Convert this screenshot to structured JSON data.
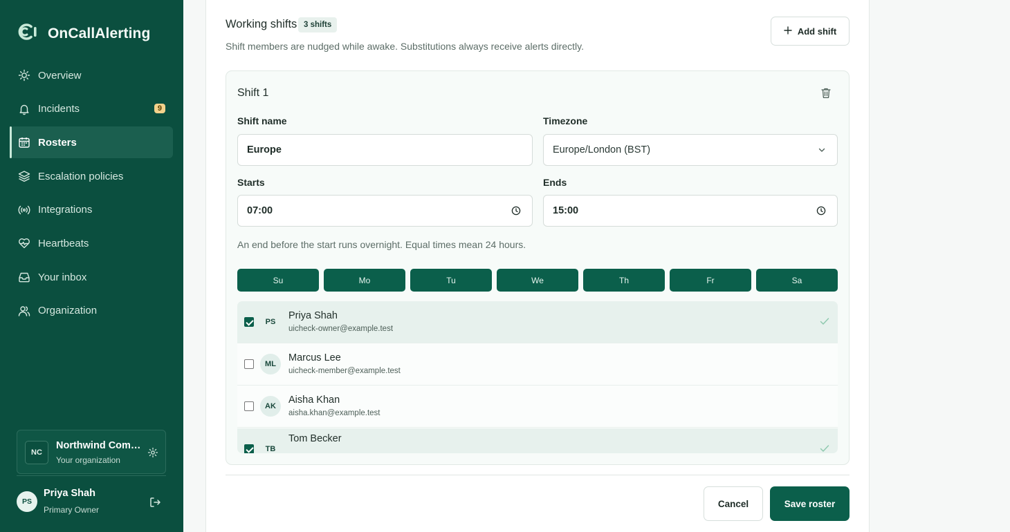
{
  "app": {
    "name": "OnCallAlerting"
  },
  "colors": {
    "sidebar": "#0b4f3f",
    "accent": "#0b5f4b",
    "badge": "#f3d28c"
  },
  "sidebar": {
    "items": [
      {
        "label": "Overview",
        "icon": "sun-icon"
      },
      {
        "label": "Incidents",
        "icon": "bell-icon",
        "badge": "9"
      },
      {
        "label": "Rosters",
        "icon": "calendar-icon",
        "active": true
      },
      {
        "label": "Escalation policies",
        "icon": "layers-icon"
      },
      {
        "label": "Integrations",
        "icon": "broadcast-icon"
      },
      {
        "label": "Heartbeats",
        "icon": "heart-pulse-icon"
      },
      {
        "label": "Your inbox",
        "icon": "inbox-icon"
      },
      {
        "label": "Organization",
        "icon": "users-icon"
      }
    ],
    "org": {
      "initials": "NC",
      "name": "Northwind Com…",
      "subtitle": "Your organization"
    },
    "user": {
      "initials": "PS",
      "name": "Priya Shah",
      "role": "Primary Owner"
    }
  },
  "main": {
    "section_title": "Working shifts",
    "shift_count": "3 shifts",
    "description": "Shift members are nudged while awake. Substitutions always receive alerts directly.",
    "add_shift_label": "Add shift",
    "shift": {
      "title": "Shift 1",
      "name_label": "Shift name",
      "name_value": "Europe",
      "timezone_label": "Timezone",
      "timezone_value": "Europe/London (BST)",
      "starts_label": "Starts",
      "starts_value": "07:00",
      "ends_label": "Ends",
      "ends_value": "15:00",
      "hint": "An end before the start runs overnight. Equal times mean 24 hours.",
      "days": [
        "Su",
        "Mo",
        "Tu",
        "We",
        "Th",
        "Fr",
        "Sa"
      ],
      "members": [
        {
          "initials": "PS",
          "name": "Priya Shah",
          "email": "uicheck-owner@example.test",
          "checked": true
        },
        {
          "initials": "ML",
          "name": "Marcus Lee",
          "email": "uicheck-member@example.test",
          "checked": false
        },
        {
          "initials": "AK",
          "name": "Aisha Khan",
          "email": "aisha.khan@example.test",
          "checked": false
        },
        {
          "initials": "TB",
          "name": "Tom Becker",
          "email": "",
          "checked": true
        }
      ]
    },
    "cancel_label": "Cancel",
    "save_label": "Save roster"
  }
}
